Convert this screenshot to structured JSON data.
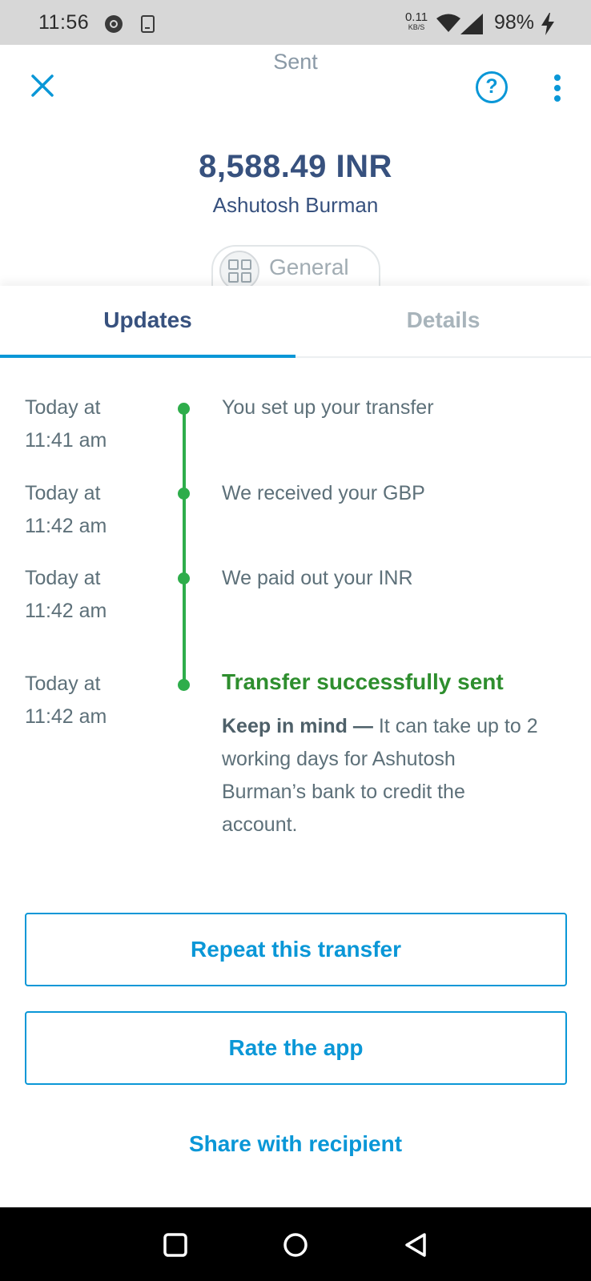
{
  "status_bar": {
    "time": "11:56",
    "net_speed_value": "0.11",
    "net_speed_unit": "KB/S",
    "battery": "98%",
    "icons": [
      "notification-icon",
      "download-icon",
      "wifi-icon",
      "signal-icon",
      "charging-icon"
    ]
  },
  "header": {
    "title": "Sent",
    "amount": "8,588.49 INR",
    "recipient": "Ashutosh Burman",
    "category": "General"
  },
  "tabs": [
    {
      "label": "Updates",
      "active": true
    },
    {
      "label": "Details",
      "active": false
    }
  ],
  "timeline": [
    {
      "time_line1": "Today at",
      "time_line2": "11:41 am",
      "text": "You set up your transfer"
    },
    {
      "time_line1": "Today at",
      "time_line2": "11:42 am",
      "text": "We received your GBP"
    },
    {
      "time_line1": "Today at",
      "time_line2": "11:42 am",
      "text": "We paid out your INR"
    },
    {
      "time_line1": "Today at",
      "time_line2": "11:42 am",
      "text": "Transfer successfully sent"
    }
  ],
  "note": {
    "bold": "Keep in mind —",
    "text": " It can take up to 2 working days for Ashutosh Burman’s bank to credit the account."
  },
  "actions": {
    "repeat": "Repeat this transfer",
    "rate": "Rate the app",
    "share": "Share with recipient"
  },
  "colors": {
    "accent": "#0a97d7",
    "success": "#2ead4b",
    "heading": "#37517e"
  }
}
